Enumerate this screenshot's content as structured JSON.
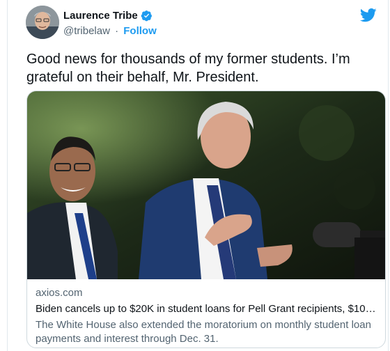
{
  "author": {
    "name": "Laurence Tribe",
    "handle": "@tribelaw",
    "separator": "·",
    "follow_label": "Follow",
    "verified_icon": "verified-badge-icon",
    "avatar_icon": "avatar"
  },
  "brand": {
    "icon": "twitter-bird-icon",
    "color": "#1d9bf0"
  },
  "tweet": {
    "text": "Good news for thousands of my former students. I’m grateful on their behalf, Mr. President."
  },
  "card": {
    "domain": "axios.com",
    "headline": "Biden cancels up to $20K in student loans for Pell Grant recipients, $10K ...",
    "description": "The White House also extended the moratorium on monthly student loan payments and interest through Dec. 31."
  }
}
